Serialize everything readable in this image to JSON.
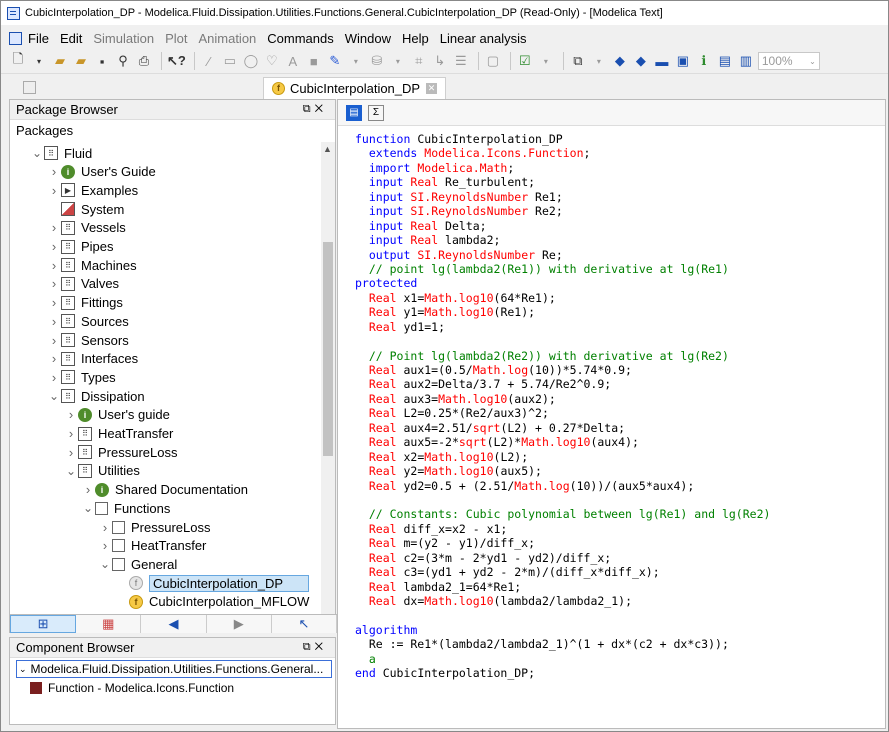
{
  "window": {
    "title": "CubicInterpolation_DP - Modelica.Fluid.Dissipation.Utilities.Functions.General.CubicInterpolation_DP  (Read-Only) - [Modelica Text]"
  },
  "menu": [
    {
      "label": "File",
      "dim": false
    },
    {
      "label": "Edit",
      "dim": false
    },
    {
      "label": "Simulation",
      "dim": true
    },
    {
      "label": "Plot",
      "dim": true
    },
    {
      "label": "Animation",
      "dim": true
    },
    {
      "label": "Commands",
      "dim": false
    },
    {
      "label": "Window",
      "dim": false
    },
    {
      "label": "Help",
      "dim": false
    },
    {
      "label": "Linear analysis",
      "dim": false
    }
  ],
  "toolbar": {
    "zoom": "100%"
  },
  "doc_tab": {
    "label": "CubicInterpolation_DP"
  },
  "package_browser": {
    "title": "Package Browser",
    "subtitle": "Packages",
    "tree": [
      {
        "level": 1,
        "arrow": "down",
        "icon": "box",
        "label": "Fluid"
      },
      {
        "level": 2,
        "arrow": "right",
        "icon": "info",
        "label": "User's Guide"
      },
      {
        "level": 2,
        "arrow": "right",
        "icon": "play",
        "label": "Examples"
      },
      {
        "level": 2,
        "arrow": "",
        "icon": "sys",
        "label": "System"
      },
      {
        "level": 2,
        "arrow": "right",
        "icon": "box",
        "label": "Vessels"
      },
      {
        "level": 2,
        "arrow": "right",
        "icon": "box",
        "label": "Pipes"
      },
      {
        "level": 2,
        "arrow": "right",
        "icon": "box",
        "label": "Machines"
      },
      {
        "level": 2,
        "arrow": "right",
        "icon": "box",
        "label": "Valves"
      },
      {
        "level": 2,
        "arrow": "right",
        "icon": "box",
        "label": "Fittings"
      },
      {
        "level": 2,
        "arrow": "right",
        "icon": "box",
        "label": "Sources"
      },
      {
        "level": 2,
        "arrow": "right",
        "icon": "box",
        "label": "Sensors"
      },
      {
        "level": 2,
        "arrow": "right",
        "icon": "box",
        "label": "Interfaces"
      },
      {
        "level": 2,
        "arrow": "right",
        "icon": "box",
        "label": "Types"
      },
      {
        "level": 2,
        "arrow": "down",
        "icon": "box",
        "label": "Dissipation"
      },
      {
        "level": 3,
        "arrow": "right",
        "icon": "info",
        "label": "User's guide"
      },
      {
        "level": 3,
        "arrow": "right",
        "icon": "box",
        "label": "HeatTransfer"
      },
      {
        "level": 3,
        "arrow": "right",
        "icon": "box",
        "label": "PressureLoss"
      },
      {
        "level": 3,
        "arrow": "down",
        "icon": "box",
        "label": "Utilities"
      },
      {
        "level": 4,
        "arrow": "right",
        "icon": "info",
        "label": "Shared Documentation"
      },
      {
        "level": 4,
        "arrow": "down",
        "icon": "check",
        "label": "Functions"
      },
      {
        "level": 5,
        "arrow": "right",
        "icon": "check",
        "label": "PressureLoss"
      },
      {
        "level": 5,
        "arrow": "right",
        "icon": "check",
        "label": "HeatTransfer"
      },
      {
        "level": 5,
        "arrow": "down",
        "icon": "check",
        "label": "General"
      },
      {
        "level": 6,
        "arrow": "",
        "icon": "fn-gray",
        "label": "CubicInterpolation_DP",
        "selected": true
      },
      {
        "level": 6,
        "arrow": "",
        "icon": "fn",
        "label": "CubicInterpolation_MFLOW"
      }
    ]
  },
  "component_browser": {
    "title": "Component Browser",
    "root": "Modelica.Fluid.Dissipation.Utilities.Functions.General...",
    "child": "Function - Modelica.Icons.Function"
  },
  "code": [
    [
      {
        "c": "kw",
        "t": "function"
      },
      {
        "c": "",
        "t": " CubicInterpolation_DP"
      }
    ],
    [
      {
        "c": "",
        "t": "  "
      },
      {
        "c": "kw",
        "t": "extends"
      },
      {
        "c": "",
        "t": " "
      },
      {
        "c": "ty",
        "t": "Modelica.Icons.Function"
      },
      {
        "c": "",
        "t": ";"
      }
    ],
    [
      {
        "c": "",
        "t": "  "
      },
      {
        "c": "kw",
        "t": "import"
      },
      {
        "c": "",
        "t": " "
      },
      {
        "c": "ty",
        "t": "Modelica.Math"
      },
      {
        "c": "",
        "t": ";"
      }
    ],
    [
      {
        "c": "",
        "t": "  "
      },
      {
        "c": "kw",
        "t": "input"
      },
      {
        "c": "",
        "t": " "
      },
      {
        "c": "ty",
        "t": "Real"
      },
      {
        "c": "",
        "t": " Re_turbulent;"
      }
    ],
    [
      {
        "c": "",
        "t": "  "
      },
      {
        "c": "kw",
        "t": "input"
      },
      {
        "c": "",
        "t": " "
      },
      {
        "c": "ty",
        "t": "SI.ReynoldsNumber"
      },
      {
        "c": "",
        "t": " Re1;"
      }
    ],
    [
      {
        "c": "",
        "t": "  "
      },
      {
        "c": "kw",
        "t": "input"
      },
      {
        "c": "",
        "t": " "
      },
      {
        "c": "ty",
        "t": "SI.ReynoldsNumber"
      },
      {
        "c": "",
        "t": " Re2;"
      }
    ],
    [
      {
        "c": "",
        "t": "  "
      },
      {
        "c": "kw",
        "t": "input"
      },
      {
        "c": "",
        "t": " "
      },
      {
        "c": "ty",
        "t": "Real"
      },
      {
        "c": "",
        "t": " Delta;"
      }
    ],
    [
      {
        "c": "",
        "t": "  "
      },
      {
        "c": "kw",
        "t": "input"
      },
      {
        "c": "",
        "t": " "
      },
      {
        "c": "ty",
        "t": "Real"
      },
      {
        "c": "",
        "t": " lambda2;"
      }
    ],
    [
      {
        "c": "",
        "t": "  "
      },
      {
        "c": "kw",
        "t": "output"
      },
      {
        "c": "",
        "t": " "
      },
      {
        "c": "ty",
        "t": "SI.ReynoldsNumber"
      },
      {
        "c": "",
        "t": " Re;"
      }
    ],
    [
      {
        "c": "",
        "t": "  "
      },
      {
        "c": "cm",
        "t": "// point lg(lambda2(Re1)) with derivative at lg(Re1)"
      }
    ],
    [
      {
        "c": "kw",
        "t": "protected"
      }
    ],
    [
      {
        "c": "",
        "t": "  "
      },
      {
        "c": "ty",
        "t": "Real"
      },
      {
        "c": "",
        "t": " x1="
      },
      {
        "c": "ty",
        "t": "Math.log10"
      },
      {
        "c": "",
        "t": "(64*Re1);"
      }
    ],
    [
      {
        "c": "",
        "t": "  "
      },
      {
        "c": "ty",
        "t": "Real"
      },
      {
        "c": "",
        "t": " y1="
      },
      {
        "c": "ty",
        "t": "Math.log10"
      },
      {
        "c": "",
        "t": "(Re1);"
      }
    ],
    [
      {
        "c": "",
        "t": "  "
      },
      {
        "c": "ty",
        "t": "Real"
      },
      {
        "c": "",
        "t": " yd1=1;"
      }
    ],
    [
      {
        "c": "",
        "t": ""
      }
    ],
    [
      {
        "c": "",
        "t": "  "
      },
      {
        "c": "cm",
        "t": "// Point lg(lambda2(Re2)) with derivative at lg(Re2)"
      }
    ],
    [
      {
        "c": "",
        "t": "  "
      },
      {
        "c": "ty",
        "t": "Real"
      },
      {
        "c": "",
        "t": " aux1=(0.5/"
      },
      {
        "c": "ty",
        "t": "Math.log"
      },
      {
        "c": "",
        "t": "(10))*5.74*0.9;"
      }
    ],
    [
      {
        "c": "",
        "t": "  "
      },
      {
        "c": "ty",
        "t": "Real"
      },
      {
        "c": "",
        "t": " aux2=Delta/3.7 + 5.74/Re2^0.9;"
      }
    ],
    [
      {
        "c": "",
        "t": "  "
      },
      {
        "c": "ty",
        "t": "Real"
      },
      {
        "c": "",
        "t": " aux3="
      },
      {
        "c": "ty",
        "t": "Math.log10"
      },
      {
        "c": "",
        "t": "(aux2);"
      }
    ],
    [
      {
        "c": "",
        "t": "  "
      },
      {
        "c": "ty",
        "t": "Real"
      },
      {
        "c": "",
        "t": " L2=0.25*(Re2/aux3)^2;"
      }
    ],
    [
      {
        "c": "",
        "t": "  "
      },
      {
        "c": "ty",
        "t": "Real"
      },
      {
        "c": "",
        "t": " aux4=2.51/"
      },
      {
        "c": "ty",
        "t": "sqrt"
      },
      {
        "c": "",
        "t": "(L2) + 0.27*Delta;"
      }
    ],
    [
      {
        "c": "",
        "t": "  "
      },
      {
        "c": "ty",
        "t": "Real"
      },
      {
        "c": "",
        "t": " aux5=-2*"
      },
      {
        "c": "ty",
        "t": "sqrt"
      },
      {
        "c": "",
        "t": "(L2)*"
      },
      {
        "c": "ty",
        "t": "Math.log10"
      },
      {
        "c": "",
        "t": "(aux4);"
      }
    ],
    [
      {
        "c": "",
        "t": "  "
      },
      {
        "c": "ty",
        "t": "Real"
      },
      {
        "c": "",
        "t": " x2="
      },
      {
        "c": "ty",
        "t": "Math.log10"
      },
      {
        "c": "",
        "t": "(L2);"
      }
    ],
    [
      {
        "c": "",
        "t": "  "
      },
      {
        "c": "ty",
        "t": "Real"
      },
      {
        "c": "",
        "t": " y2="
      },
      {
        "c": "ty",
        "t": "Math.log10"
      },
      {
        "c": "",
        "t": "(aux5);"
      }
    ],
    [
      {
        "c": "",
        "t": "  "
      },
      {
        "c": "ty",
        "t": "Real"
      },
      {
        "c": "",
        "t": " yd2=0.5 + (2.51/"
      },
      {
        "c": "ty",
        "t": "Math.log"
      },
      {
        "c": "",
        "t": "(10))/(aux5*aux4);"
      }
    ],
    [
      {
        "c": "",
        "t": ""
      }
    ],
    [
      {
        "c": "",
        "t": "  "
      },
      {
        "c": "cm",
        "t": "// Constants: Cubic polynomial between lg(Re1) and lg(Re2)"
      }
    ],
    [
      {
        "c": "",
        "t": "  "
      },
      {
        "c": "ty",
        "t": "Real"
      },
      {
        "c": "",
        "t": " diff_x=x2 - x1;"
      }
    ],
    [
      {
        "c": "",
        "t": "  "
      },
      {
        "c": "ty",
        "t": "Real"
      },
      {
        "c": "",
        "t": " m=(y2 - y1)/diff_x;"
      }
    ],
    [
      {
        "c": "",
        "t": "  "
      },
      {
        "c": "ty",
        "t": "Real"
      },
      {
        "c": "",
        "t": " c2=(3*m - 2*yd1 - yd2)/diff_x;"
      }
    ],
    [
      {
        "c": "",
        "t": "  "
      },
      {
        "c": "ty",
        "t": "Real"
      },
      {
        "c": "",
        "t": " c3=(yd1 + yd2 - 2*m)/(diff_x*diff_x);"
      }
    ],
    [
      {
        "c": "",
        "t": "  "
      },
      {
        "c": "ty",
        "t": "Real"
      },
      {
        "c": "",
        "t": " lambda2_1=64*Re1;"
      }
    ],
    [
      {
        "c": "",
        "t": "  "
      },
      {
        "c": "ty",
        "t": "Real"
      },
      {
        "c": "",
        "t": " dx="
      },
      {
        "c": "ty",
        "t": "Math.log10"
      },
      {
        "c": "",
        "t": "(lambda2/lambda2_1);"
      }
    ],
    [
      {
        "c": "",
        "t": ""
      }
    ],
    [
      {
        "c": "kw",
        "t": "algorithm"
      }
    ],
    [
      {
        "c": "",
        "t": "  Re := Re1*(lambda2/lambda2_1)^(1 + dx*(c2 + dx*c3));"
      }
    ],
    [
      {
        "c": "",
        "t": "  "
      },
      {
        "c": "cm",
        "t": "a"
      }
    ],
    [
      {
        "c": "kw",
        "t": "end"
      },
      {
        "c": "",
        "t": " CubicInterpolation_DP;"
      }
    ]
  ]
}
